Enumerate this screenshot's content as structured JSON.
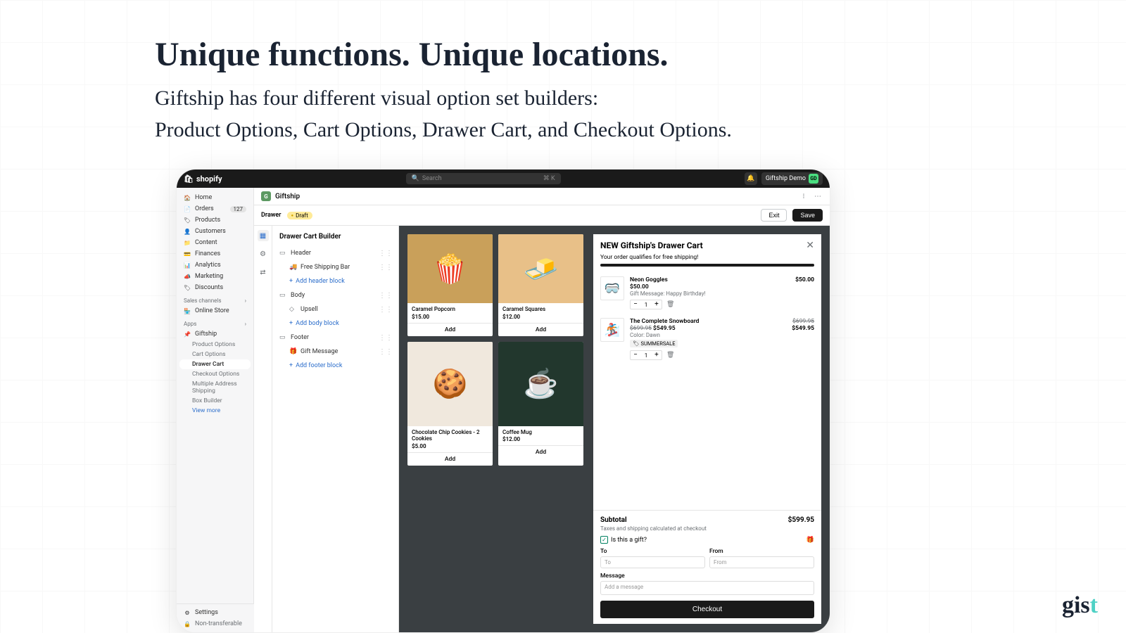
{
  "hero": {
    "title": "Unique functions. Unique locations.",
    "subtitle": "Giftship has four different visual option set builders:\nProduct Options, Cart Options, Drawer Cart, and Checkout Options."
  },
  "topbar": {
    "logo": "shopify",
    "search_placeholder": "Search",
    "search_shortcut": "⌘ K",
    "store_name": "Giftship Demo",
    "store_initials": "GD"
  },
  "sidebar": {
    "items": [
      {
        "icon": "🏠",
        "label": "Home"
      },
      {
        "icon": "📄",
        "label": "Orders",
        "badge": "127"
      },
      {
        "icon": "🏷",
        "label": "Products"
      },
      {
        "icon": "👤",
        "label": "Customers"
      },
      {
        "icon": "📁",
        "label": "Content"
      },
      {
        "icon": "💳",
        "label": "Finances"
      },
      {
        "icon": "📊",
        "label": "Analytics"
      },
      {
        "icon": "📣",
        "label": "Marketing"
      },
      {
        "icon": "🏷",
        "label": "Discounts"
      }
    ],
    "sales_channels_label": "Sales channels",
    "online_store": {
      "icon": "🏪",
      "label": "Online Store"
    },
    "apps_label": "Apps",
    "giftship_label": "Giftship",
    "giftship_subitems": [
      "Product Options",
      "Cart Options",
      "Drawer Cart",
      "Checkout Options",
      "Multiple Address Shipping",
      "Box Builder"
    ],
    "view_more": "View more",
    "settings": {
      "icon": "⚙",
      "label": "Settings"
    },
    "non_transferable": "Non-transferable"
  },
  "page": {
    "app_name": "Giftship",
    "breadcrumb": "Drawer",
    "draft_label": "Draft",
    "exit": "Exit",
    "save": "Save"
  },
  "builder": {
    "title": "Drawer Cart Builder",
    "sections": [
      {
        "icon": "▭",
        "label": "Header",
        "children": [
          {
            "icon": "🚚",
            "label": "Free Shipping Bar"
          }
        ],
        "add": "Add header block"
      },
      {
        "icon": "▭",
        "label": "Body",
        "children": [
          {
            "icon": "◇",
            "label": "Upsell"
          }
        ],
        "add": "Add body block"
      },
      {
        "icon": "▭",
        "label": "Footer",
        "children": [
          {
            "icon": "🎁",
            "label": "Gift Message"
          }
        ],
        "add": "Add footer block"
      }
    ]
  },
  "products": [
    {
      "emoji": "🍿",
      "bg": "#c9a05a",
      "name": "Caramel Popcorn",
      "price": "$15.00"
    },
    {
      "emoji": "🧈",
      "bg": "#e8c088",
      "name": "Caramel Squares",
      "price": "$12.00"
    },
    {
      "emoji": "🍪",
      "bg": "#f0e8dd",
      "name": "Chocolate Chip Cookies - 2 Cookies",
      "price": "$5.00",
      "tall": true
    },
    {
      "emoji": "☕",
      "bg": "#22372d",
      "name": "Coffee Mug",
      "price": "$12.00",
      "tall": true
    }
  ],
  "add_label": "Add",
  "drawer": {
    "title": "NEW Giftship's Drawer Cart",
    "ship_note": "Your order qualifies for free shipping!",
    "items": [
      {
        "emoji": "🥽",
        "name": "Neon Goggles",
        "price": "$50.00",
        "line_price": "$50.00",
        "meta": "Gift Message: Happy Birthday!",
        "qty": "1"
      },
      {
        "emoji": "🏂",
        "name": "The Complete Snowboard",
        "compare": "$699.95",
        "price": "$549.95",
        "line_compare": "$699.95",
        "line_price": "$549.95",
        "meta": "Color: Dawn",
        "tag": "SUMMERSALE",
        "qty": "1"
      }
    ],
    "subtotal_label": "Subtotal",
    "subtotal_value": "$599.95",
    "tax_note": "Taxes and shipping calculated at checkout",
    "gift_label": "Is this a gift?",
    "to_label": "To",
    "to_placeholder": "To",
    "from_label": "From",
    "from_placeholder": "From",
    "message_label": "Message",
    "message_placeholder": "Add a message",
    "checkout": "Checkout"
  },
  "brand": "gist"
}
